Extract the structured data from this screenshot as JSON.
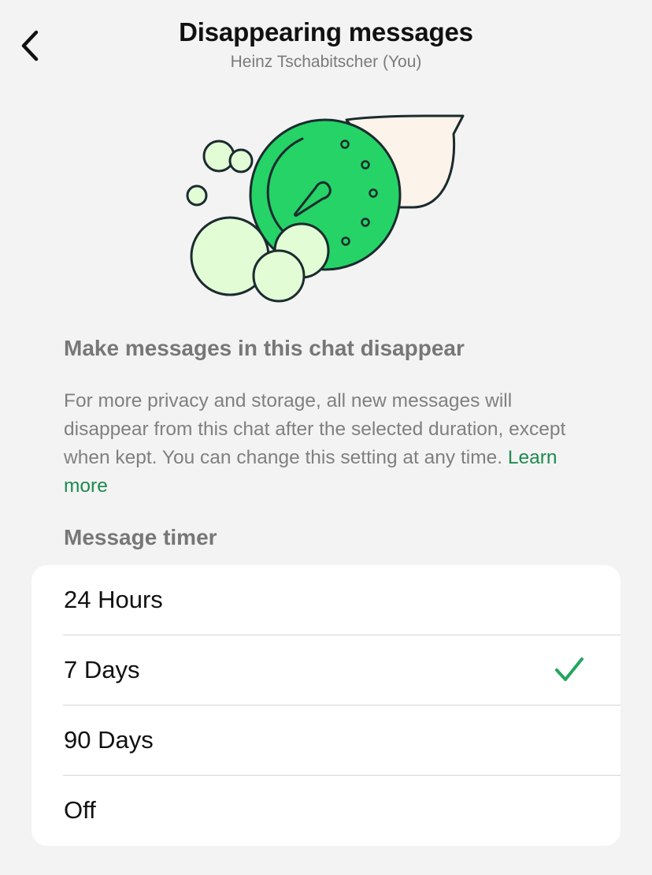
{
  "header": {
    "title": "Disappearing messages",
    "subtitle": "Heinz Tschabitscher (You)",
    "back_icon": "chevron-left-icon"
  },
  "illustration": {
    "icon": "disappearing-timer-illustration",
    "colors": {
      "timer": "#25d366",
      "bubbles": "#e2fcd6",
      "speech_bubble": "#fcf3ea",
      "outline": "#1b2b2e"
    }
  },
  "main": {
    "heading": "Make messages in this chat disappear",
    "description": "For more privacy and storage, all new messages will disappear from this chat after the selected duration, except when kept. You can change this setting at any time.",
    "learn_more": "Learn more"
  },
  "timer": {
    "label": "Message timer",
    "options": [
      {
        "label": "24 Hours",
        "selected": false
      },
      {
        "label": "7 Days",
        "selected": true
      },
      {
        "label": "90 Days",
        "selected": false
      },
      {
        "label": "Off",
        "selected": false
      }
    ],
    "check_icon": "checkmark-icon",
    "accent_color": "#25a560"
  }
}
